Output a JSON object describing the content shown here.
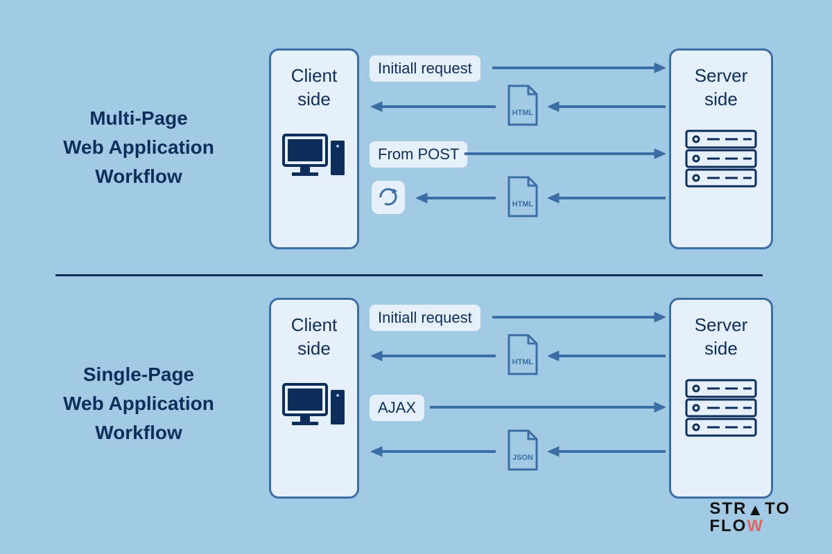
{
  "top": {
    "title_l1": "Multi-Page",
    "title_l2": "Web Application",
    "title_l3": "Workflow",
    "client_l1": "Client",
    "client_l2": "side",
    "server_l1": "Server",
    "server_l2": "side",
    "row1_label": "Initiall request",
    "row3_label": "From POST",
    "file2_label": "HTML",
    "file4_label": "HTML"
  },
  "bottom": {
    "title_l1": "Single-Page",
    "title_l2": "Web Application",
    "title_l3": "Workflow",
    "client_l1": "Client",
    "client_l2": "side",
    "server_l1": "Server",
    "server_l2": "side",
    "row1_label": "Initiall request",
    "row3_label": "AJAX",
    "file2_label": "HTML",
    "file4_label": "JSON"
  },
  "brand": {
    "l1": "STR",
    "l1b": "TO",
    "l2a": "FLO",
    "l2b": "W"
  },
  "colors": {
    "bg": "#a3cae5",
    "card": "#e5f0fa",
    "border": "#3a6ea5",
    "text": "#0d2d5a"
  }
}
